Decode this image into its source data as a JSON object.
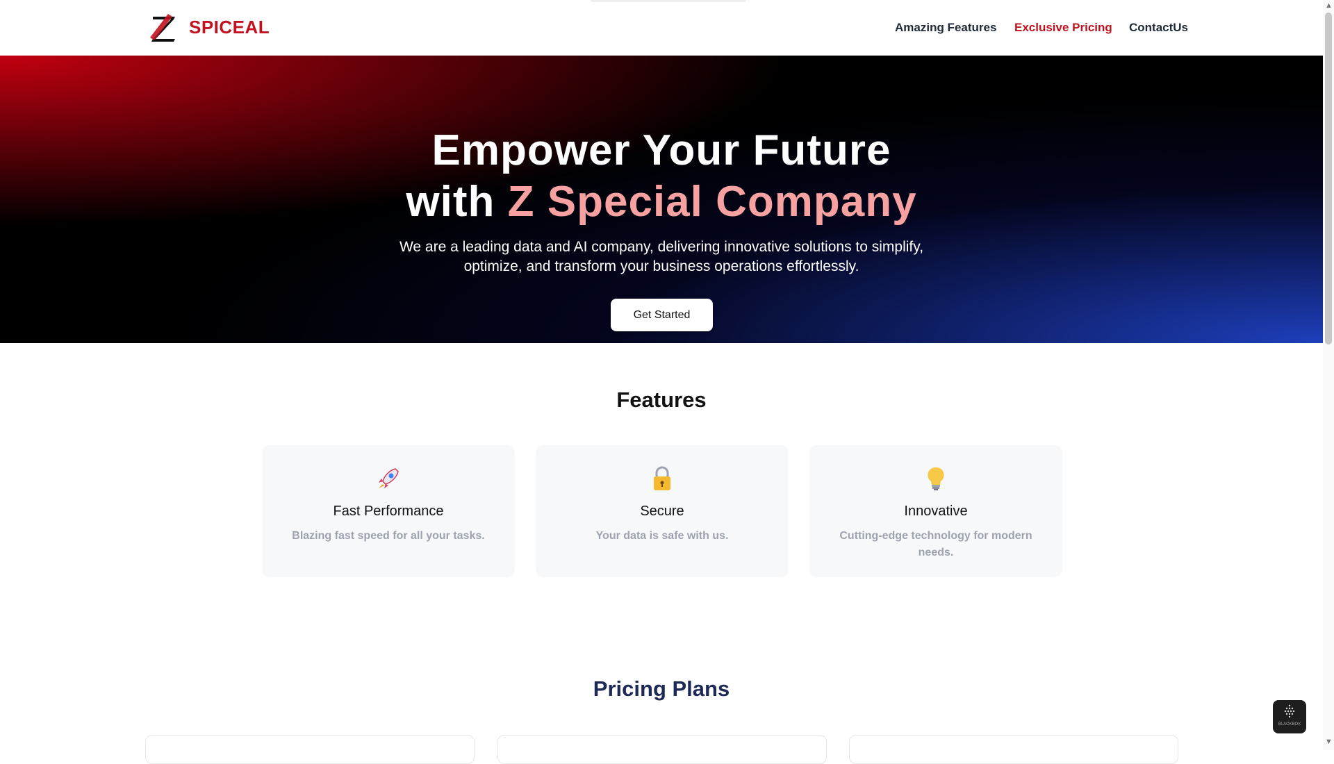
{
  "header": {
    "brand": "SPICEAL",
    "nav": [
      {
        "label": "Amazing Features",
        "active": false
      },
      {
        "label": "Exclusive Pricing",
        "active": true
      },
      {
        "label": "ContactUs",
        "active": false
      }
    ]
  },
  "hero": {
    "title_line1": "Empower Your Future",
    "title_line2_prefix": "with",
    "title_line2_accent": "Z Special Company",
    "subtitle": "We are a leading data and AI company, delivering innovative solutions to simplify, optimize, and transform your business operations effortlessly.",
    "cta_label": "Get Started"
  },
  "features": {
    "title": "Features",
    "items": [
      {
        "icon": "rocket-icon",
        "title": "Fast Performance",
        "desc": "Blazing fast speed for all your tasks."
      },
      {
        "icon": "lock-icon",
        "title": "Secure",
        "desc": "Your data is safe with us."
      },
      {
        "icon": "lightbulb-icon",
        "title": "Innovative",
        "desc": "Cutting-edge technology for modern needs."
      }
    ]
  },
  "pricing": {
    "title": "Pricing Plans"
  },
  "widget": {
    "label": "BLACKBOX"
  },
  "colors": {
    "brand_red": "#c1121f",
    "accent_pink": "#f7a1a1",
    "pricing_navy": "#1e2a55"
  }
}
